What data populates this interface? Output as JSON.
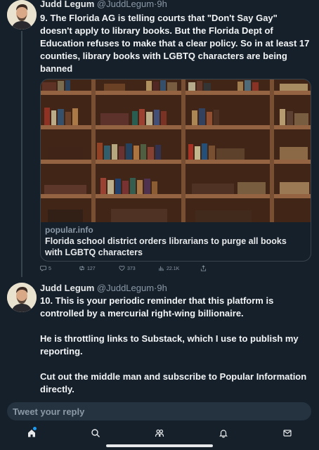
{
  "tweets": [
    {
      "author": "Judd Legum",
      "handle": "@JuddLegum",
      "separator": "·",
      "time": "9h",
      "text": "9. The Florida AG is telling courts that \"Don't Say Gay\" doesn't apply to library books. But the Florida Dept of Education refuses to make that a clear policy. So in at least 17 counties, library books with LGBTQ characters are being banned",
      "card": {
        "domain": "popular.info",
        "title": "Florida school district orders librarians to purge all books with LGBTQ characters"
      },
      "actions": {
        "replies": "5",
        "retweets": "127",
        "likes": "373",
        "views": "22.1K"
      }
    },
    {
      "author": "Judd Legum",
      "handle": "@JuddLegum",
      "separator": "·",
      "time": "9h",
      "paragraphs": [
        "10. This is your periodic reminder that this platform is controlled by a mercurial right-wing billionaire.",
        "He is throttling links to Substack, which I use to publish my reporting.",
        "Cut out the middle man and subscribe to Popular Information directly."
      ]
    }
  ],
  "reply_bar": {
    "placeholder": "Tweet your reply"
  },
  "icons": {
    "reply": "reply-icon",
    "retweet": "retweet-icon",
    "like": "heart-icon",
    "views": "analytics-icon",
    "share": "share-icon",
    "nav_home": "home-icon",
    "nav_search": "search-icon",
    "nav_communities": "communities-icon",
    "nav_notifications": "bell-icon",
    "nav_messages": "mail-icon"
  },
  "colors": {
    "background": "#15202b",
    "accent": "#1d9bf0",
    "muted_text": "#8b98a5",
    "border": "#38444d"
  }
}
